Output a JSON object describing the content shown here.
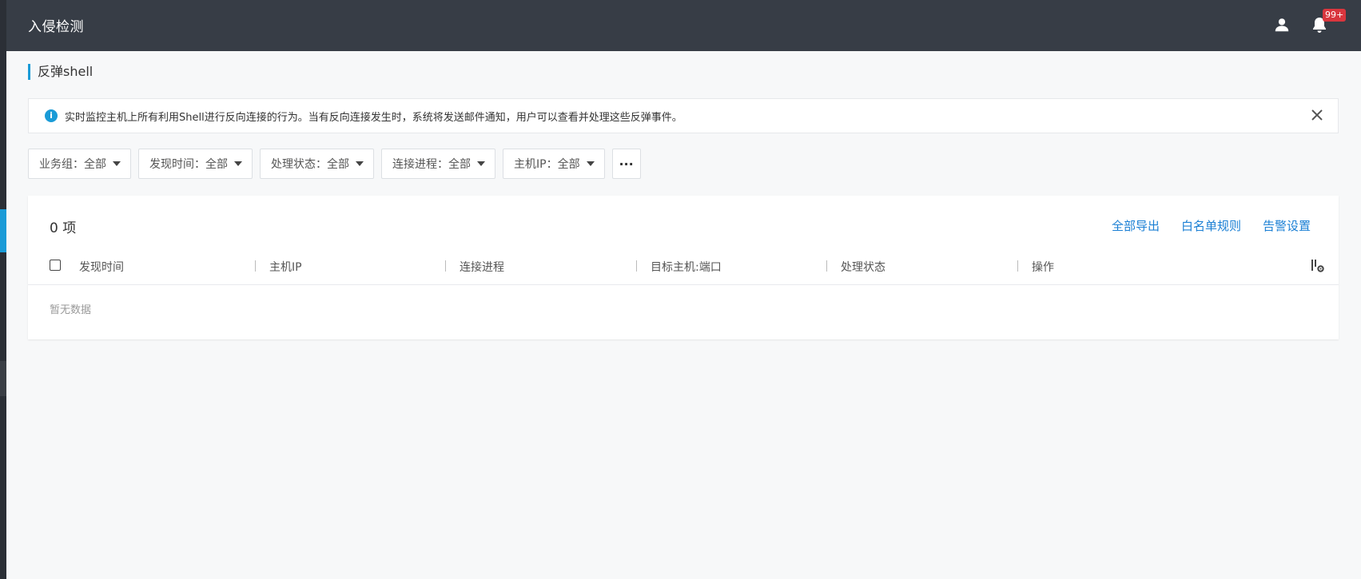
{
  "app": {
    "title": "入侵检测",
    "notification_badge": "99+"
  },
  "page": {
    "title": "反弹shell"
  },
  "notice": {
    "text": "实时监控主机上所有利用Shell进行反向连接的行为。当有反向连接发生时，系统将发送邮件通知，用户可以查看并处理这些反弹事件。"
  },
  "filters": [
    {
      "label": "业务组：全部"
    },
    {
      "label": "发现时间：全部"
    },
    {
      "label": "处理状态：全部"
    },
    {
      "label": "连接进程：全部"
    },
    {
      "label": "主机IP：全部"
    }
  ],
  "more_label": "···",
  "table": {
    "count_label": "0 项",
    "actions": [
      "全部导出",
      "白名单规则",
      "告警设置"
    ],
    "columns": [
      "发现时间",
      "主机IP",
      "连接进程",
      "目标主机:端口",
      "处理状态",
      "操作"
    ],
    "empty_text": "暂无数据"
  },
  "colors": {
    "topbar": "#373d46",
    "accent": "#1a9bd7",
    "link": "#1a7fd4",
    "badge": "#d9363e"
  },
  "icons": [
    "user-icon",
    "bell-icon",
    "info-icon",
    "close-icon",
    "column-settings-icon",
    "chevron-down-icon"
  ]
}
